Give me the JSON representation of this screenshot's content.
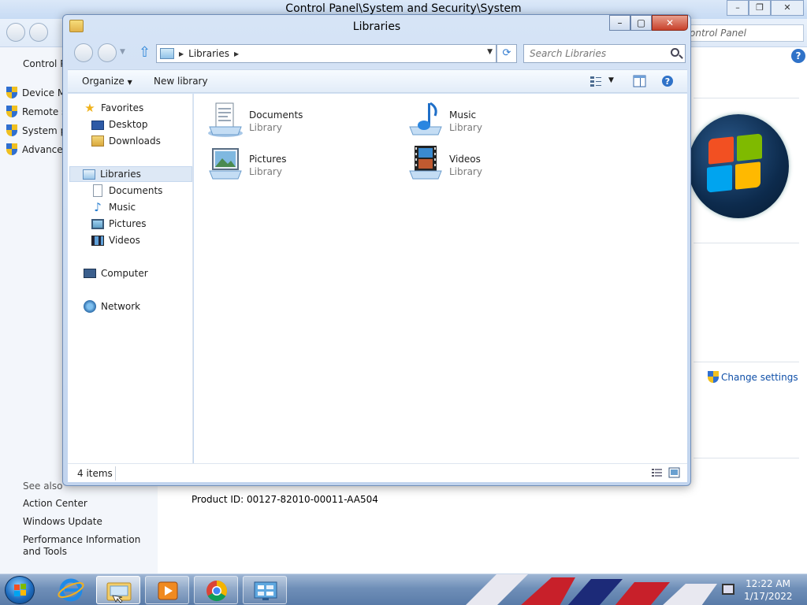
{
  "background_window": {
    "title": "Control Panel\\System and Security\\System",
    "search_placeholder": "Search Control Panel",
    "search_visible": "ontrol Panel",
    "sidebar": {
      "home_label": "Control P",
      "links": [
        "Device M",
        "Remote s",
        "System p",
        "Advanced"
      ],
      "see_also_label": "See also",
      "see_also_links": [
        "Action Center",
        "Windows Update",
        "Performance Information and Tools"
      ]
    },
    "product_id": "Product ID: 00127-82010-00011-AA504",
    "change_settings": "Change settings"
  },
  "libraries_window": {
    "title": "Libraries",
    "address_crumb": "Libraries",
    "search_placeholder": "Search Libraries",
    "toolbar": {
      "organize": "Organize",
      "new_library": "New library"
    },
    "nav_pane": {
      "favorites_header": "Favorites",
      "favorites": [
        "Desktop",
        "Downloads"
      ],
      "libraries_header": "Libraries",
      "libraries": [
        "Documents",
        "Music",
        "Pictures",
        "Videos"
      ],
      "computer": "Computer",
      "network": "Network"
    },
    "items": [
      {
        "name": "Documents",
        "type": "Library"
      },
      {
        "name": "Music",
        "type": "Library"
      },
      {
        "name": "Pictures",
        "type": "Library"
      },
      {
        "name": "Videos",
        "type": "Library"
      }
    ],
    "status_count": "4 items"
  },
  "taskbar": {
    "clock_time": "12:22 AM",
    "clock_date": "1/17/2022"
  }
}
